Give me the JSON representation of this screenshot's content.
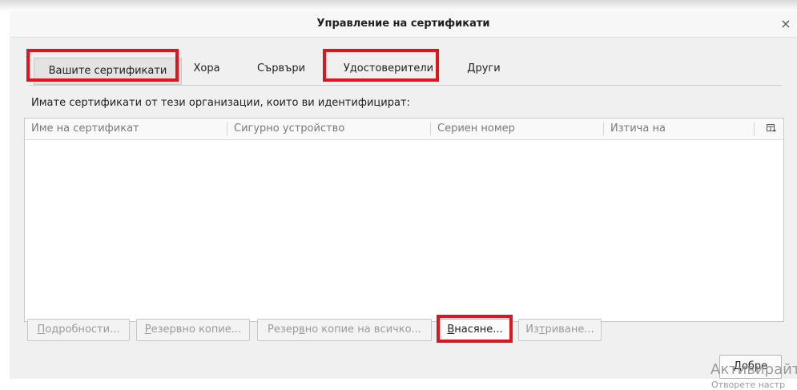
{
  "window": {
    "title": "Управление на сертификати",
    "close_glyph": "×"
  },
  "tabs": [
    {
      "label": "Вашите сертификати",
      "selected": true
    },
    {
      "label": "Хора",
      "selected": false
    },
    {
      "label": "Сървъри",
      "selected": false
    },
    {
      "label": "Удостоверители",
      "selected": false
    },
    {
      "label": "Други",
      "selected": false
    }
  ],
  "description": "Имате сертификати от тези организации, които ви идентифицират:",
  "table": {
    "columns": [
      "Име на сертификат",
      "Сигурно устройство",
      "Сериен номер",
      "Изтича на"
    ],
    "rows": [],
    "column_picker_icon": "column-picker-icon"
  },
  "buttons": {
    "details": {
      "pre": "",
      "u": "П",
      "post": "одробности...",
      "enabled": false
    },
    "backup": {
      "pre": "",
      "u": "Р",
      "post": "езервно копие...",
      "enabled": false
    },
    "backup_all": {
      "pre": "Резер",
      "u": "в",
      "post": "но копие на всичко...",
      "enabled": false
    },
    "import": {
      "pre": "",
      "u": "В",
      "post": "насяне...",
      "enabled": true
    },
    "delete": {
      "pre": "Из",
      "u": "т",
      "post": "риване...",
      "enabled": false
    }
  },
  "ok_button": "Добре",
  "watermark": {
    "line1": "Активирайте",
    "line2": "Отворете настр"
  },
  "colors": {
    "highlight": "#e0141c",
    "dialog_bg": "#f0f0f0"
  }
}
